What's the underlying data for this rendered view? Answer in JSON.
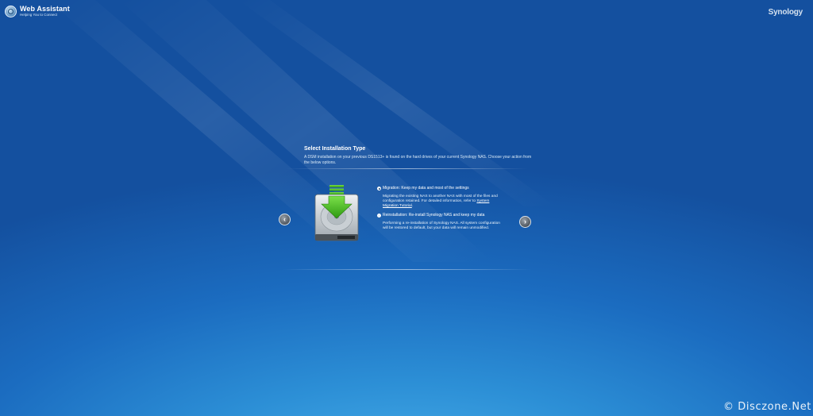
{
  "header": {
    "app_title": "Web Assistant",
    "app_subtitle": "Helping You to Connect",
    "brand": "Synology"
  },
  "panel": {
    "title": "Select Installation Type",
    "description": "A DSM installation on your previous DS1513+ is found on the hard drives of your current Synology NAS. Choose your action from the below options.",
    "options": [
      {
        "label": "Migration: Keep my data and most of the settings",
        "description": "Migrating the existing NAS to another NAS with most of the files and configuration retained. For detailed information, refer to ",
        "link": "System Migration Tutorial",
        "description_end": ".",
        "selected": true
      },
      {
        "label": "Reinstallation: Re-install Synology NAS and keep my data",
        "description": "Performing a re-installation of Synology NAS. All system configuration will be restored to default, but your data will remain unmodified.",
        "selected": false
      }
    ]
  },
  "navigation": {
    "prev_icon": "chevron-left-icon",
    "next_icon": "chevron-right-icon",
    "prev_glyph": "‹",
    "next_glyph": "›"
  },
  "watermark": "© Disczone.Net",
  "colors": {
    "background": "#1b6cc0",
    "arrow_green": "#3fb51e"
  }
}
